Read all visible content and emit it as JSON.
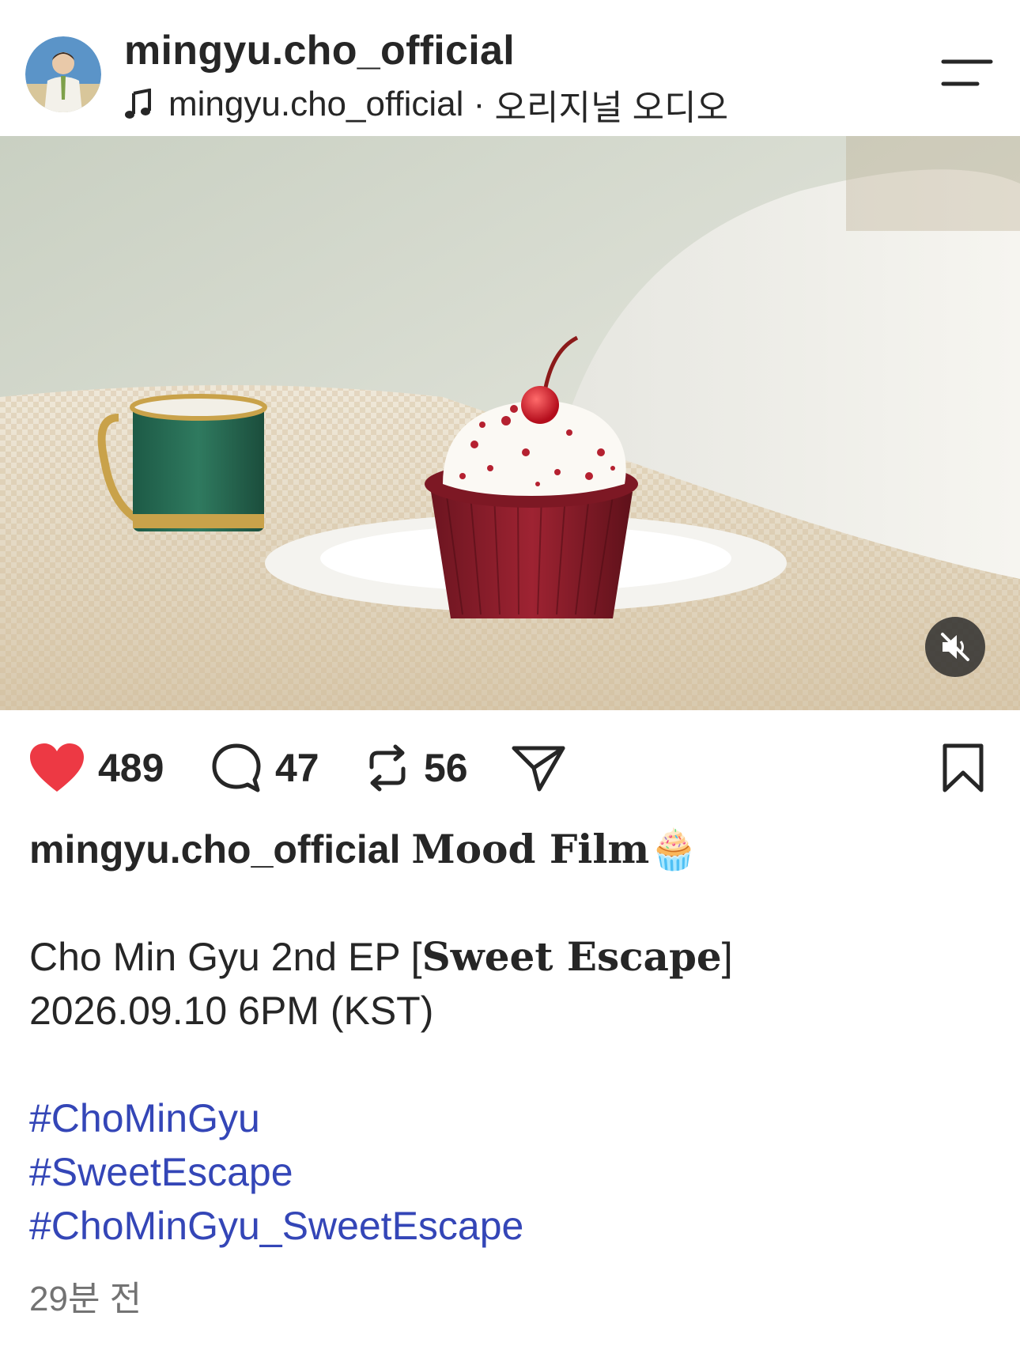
{
  "header": {
    "username": "mingyu.cho_official",
    "audio_owner": "mingyu.cho_official",
    "audio_separator": " · ",
    "audio_label": "오리지널 오디오"
  },
  "media": {
    "type": "video",
    "muted": true,
    "scene": "red velvet cupcake with cherry on white plate beside green mug"
  },
  "actions": {
    "likes": "489",
    "comments": "47",
    "reposts": "56",
    "liked": true,
    "like_color": "#ed3944"
  },
  "caption": {
    "username": "mingyu.cho_official",
    "title": "Mood Film",
    "title_emoji": "🧁",
    "line1_prefix": "Cho Min Gyu 2nd EP [",
    "line1_title": "Sweet Escape",
    "line1_suffix": "]",
    "line2": "2026.09.10 6PM (KST)",
    "hashtags": [
      "#ChoMinGyu",
      "#SweetEscape",
      "#ChoMinGyu_SweetEscape"
    ]
  },
  "timestamp": "29분 전",
  "colors": {
    "text": "#262626",
    "hashtag": "#3446b7",
    "muted_text": "#737373"
  }
}
